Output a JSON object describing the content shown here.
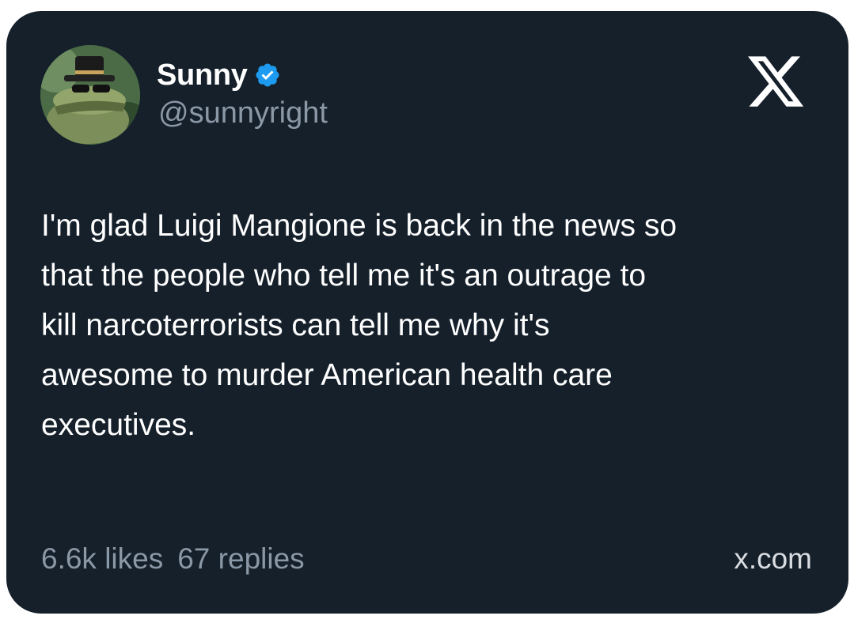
{
  "author": {
    "display_name": "Sunny",
    "handle": "@sunnyright",
    "verified": true,
    "verified_color": "#1d9bf0"
  },
  "logo_icon": "x-logo-icon",
  "tweet": {
    "text": "I'm glad Luigi Mangione is back in the news so\nthat the people who tell me it's an outrage to\nkill narcoterrorists can tell me why it's\nawesome to murder American health care\nexecutives."
  },
  "stats": {
    "likes": "6.6k likes",
    "replies": "67 replies"
  },
  "site": "x.com",
  "colors": {
    "card_background": "#15202b",
    "text_primary": "#ffffff",
    "text_secondary": "#8b98a5"
  }
}
